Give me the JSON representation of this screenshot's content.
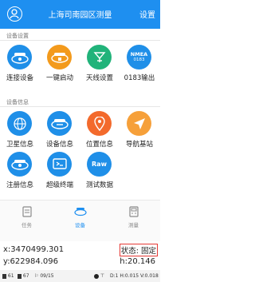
{
  "header": {
    "title": "上海司南园区测量",
    "settings_label": "设置"
  },
  "sections": {
    "device_settings": "设备设置",
    "device_info": "设备信息"
  },
  "row1": [
    {
      "label": "连接设备",
      "icon": "connect-device-icon",
      "color": "#1f8fe8"
    },
    {
      "label": "一键启动",
      "icon": "quick-start-icon",
      "color": "#f39a1c"
    },
    {
      "label": "天线设置",
      "icon": "antenna-settings-icon",
      "color": "#21b37a"
    },
    {
      "label": "0183输出",
      "icon": "nmea-output-icon",
      "color": "#1f8fe8",
      "icon_text_top": "NMEA",
      "icon_text_bottom": "0183"
    }
  ],
  "row2": [
    {
      "label": "卫星信息",
      "icon": "satellite-info-icon",
      "color": "#1f8fe8"
    },
    {
      "label": "设备信息",
      "icon": "device-info-icon",
      "color": "#1f8fe8"
    },
    {
      "label": "位置信息",
      "icon": "location-info-icon",
      "color": "#f36a2c"
    },
    {
      "label": "导航基站",
      "icon": "navigation-base-icon",
      "color": "#f6a03a"
    }
  ],
  "row3": [
    {
      "label": "注册信息",
      "icon": "registration-info-icon",
      "color": "#1f8fe8"
    },
    {
      "label": "超级终端",
      "icon": "terminal-icon",
      "color": "#1f8fe8"
    },
    {
      "label": "测试数据",
      "icon": "raw-data-icon",
      "color": "#1f8fe8",
      "icon_text": "Raw"
    }
  ],
  "nav": [
    {
      "label": "任务",
      "icon": "task-icon",
      "active": false
    },
    {
      "label": "设备",
      "icon": "device-icon",
      "active": true
    },
    {
      "label": "测量",
      "icon": "measure-icon",
      "active": false
    }
  ],
  "coords": {
    "x": "x:3470499.301",
    "y": "y:622984.096",
    "state": "状态: 固定",
    "h": "h:20.146"
  },
  "statusbar": {
    "sat1": "61",
    "sat2": "67",
    "date": "09/15",
    "info": "D:1 H:0.015 V:0.018"
  }
}
